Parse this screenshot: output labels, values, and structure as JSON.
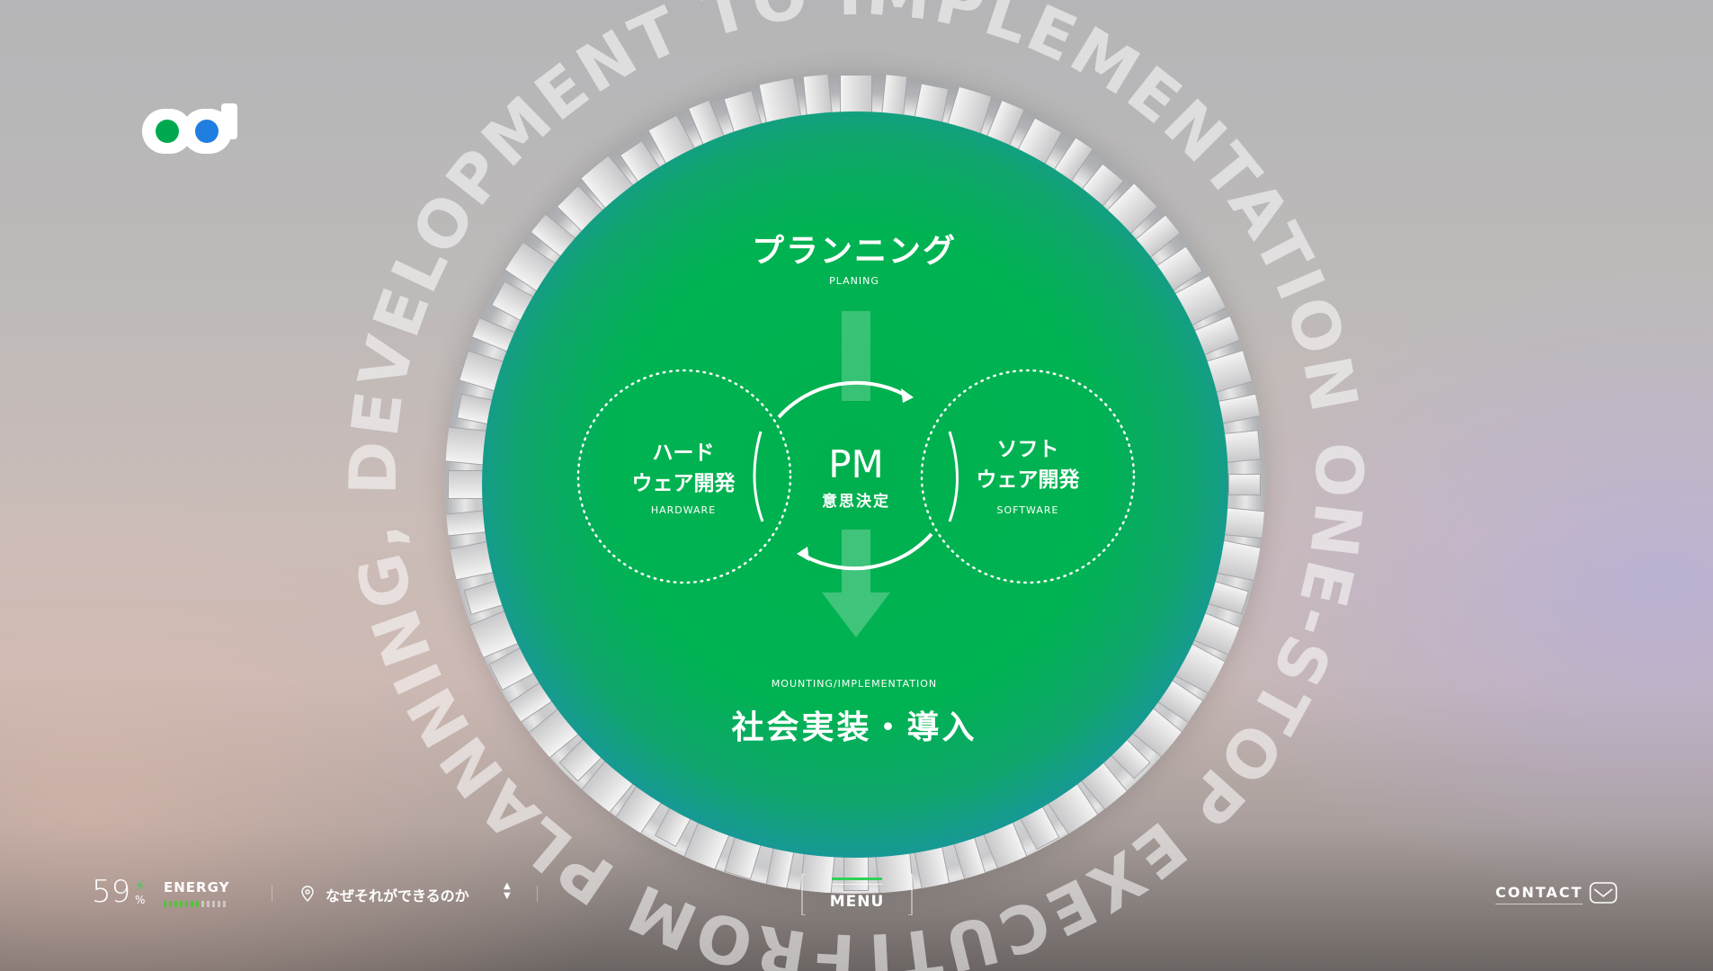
{
  "brand": {
    "logo_alt": "od",
    "logo_left_color": "#00a94f",
    "logo_right_color": "#1f7ee0"
  },
  "ring_text": "FROM PLANNING, DEVELOPMENT TO IMPLEMENTATION ONE-STOP EXECUTIONA",
  "diagram": {
    "planning_jp": "プランニング",
    "planning_en": "PLANING",
    "pm_title": "PM",
    "pm_sub": "意思決定",
    "hardware_jp_line1": "ハード",
    "hardware_jp_line2": "ウェア開発",
    "hardware_en": "HARDWARE",
    "software_jp_line1": "ソフト",
    "software_jp_line2": "ウェア開発",
    "software_en": "SOFTWARE",
    "implementation_en": "MOUNTING/IMPLEMENTATION",
    "implementation_jp": "社会実装・導入"
  },
  "footer": {
    "energy_value": "59",
    "energy_unit": "%",
    "energy_label": "ENERGY",
    "energy_level": 0.59,
    "location_text": "なぜそれができるのか",
    "menu_label": "MENU",
    "contact_label": "CONTACT"
  },
  "colors": {
    "accent_green": "#00b04e",
    "accent_blue": "#2d7fe3"
  },
  "icons": [
    "location-pin-icon",
    "up-down-arrows-icon",
    "mail-icon",
    "bolt-icon"
  ]
}
